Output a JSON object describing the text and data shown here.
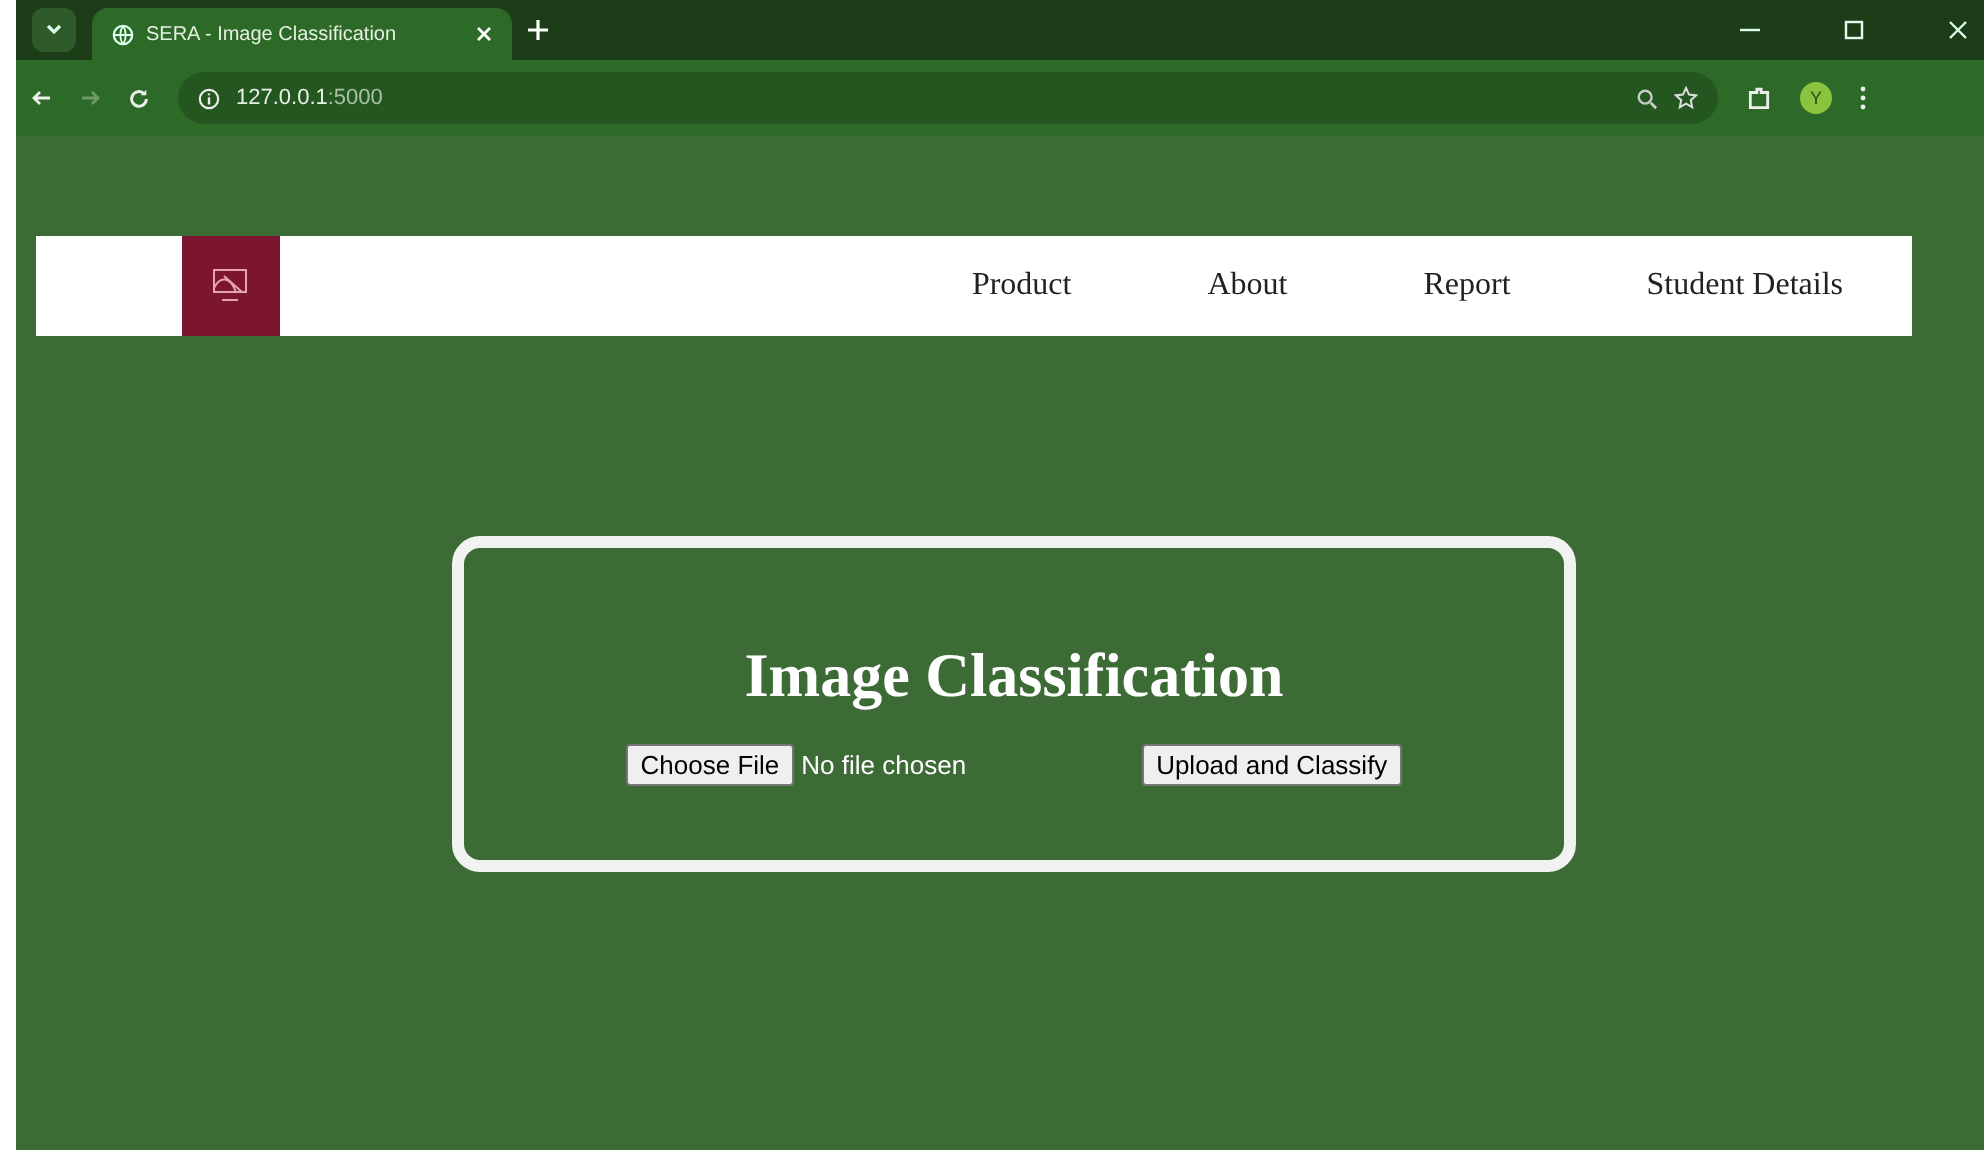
{
  "browser": {
    "tab_title": "SERA - Image Classification",
    "url_host": "127.0.0.1",
    "url_port": ":5000",
    "profile_initial": "Y"
  },
  "nav": {
    "links": [
      "Product",
      "About",
      "Report",
      "Student Details"
    ]
  },
  "card": {
    "title": "Image Classification",
    "file_button": "Choose File",
    "file_status": "No file chosen",
    "submit": "Upload and Classify"
  }
}
